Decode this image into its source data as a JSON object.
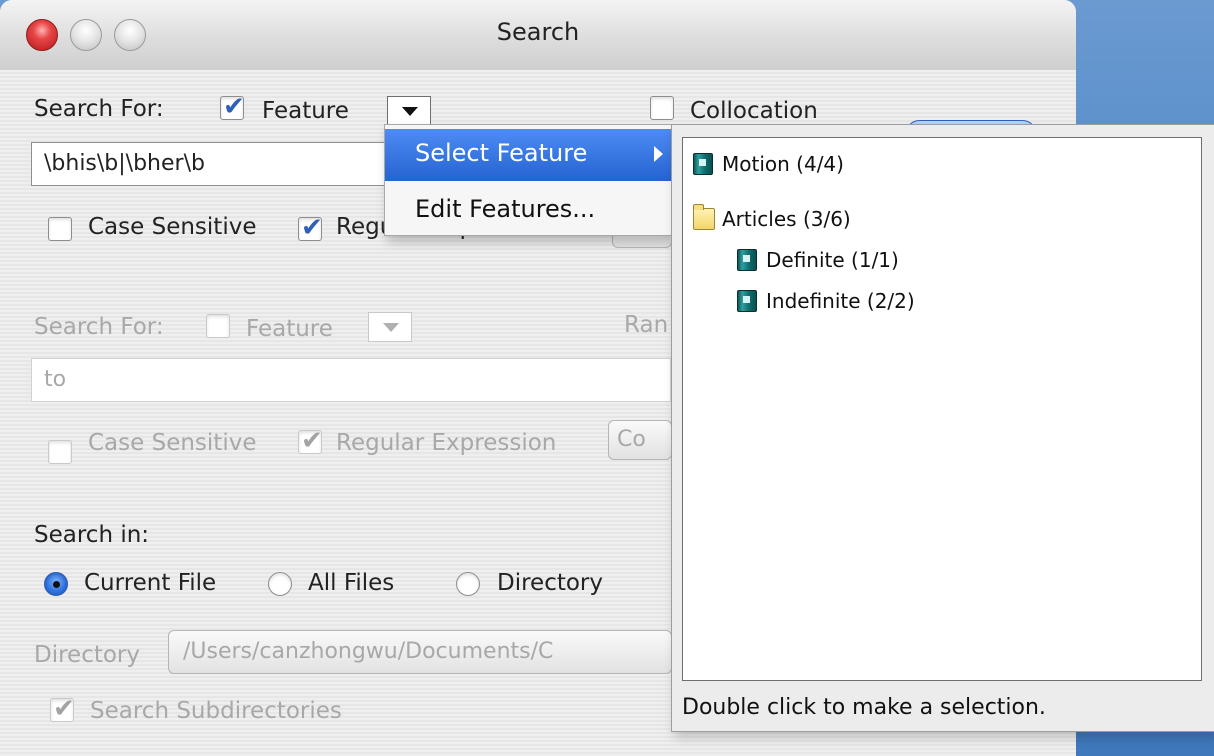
{
  "window": {
    "title": "Search"
  },
  "search1": {
    "label": "Search For:",
    "feature_label": "Feature",
    "feature_checked": true,
    "collocation_label": "Collocation",
    "collocation_checked": false,
    "query_value": "\\bhis\\b|\\bher\\b",
    "case_sensitive_label": "Case Sensitive",
    "case_sensitive_checked": false,
    "regex_label": "Regular Expression",
    "regex_checked": true
  },
  "menu": {
    "items": [
      {
        "label": "Select Feature",
        "highlighted": true,
        "has_submenu": true
      },
      {
        "label": "Edit Features...",
        "highlighted": false,
        "has_submenu": false
      }
    ]
  },
  "feature_panel": {
    "tree": [
      {
        "label": "Motion (4/4)",
        "icon": "book-icon",
        "level": 0
      },
      {
        "label": "Articles (3/6)",
        "icon": "folder-icon",
        "level": 0
      },
      {
        "label": "Definite (1/1)",
        "icon": "book-icon",
        "level": 1
      },
      {
        "label": "Indefinite (2/2)",
        "icon": "book-icon",
        "level": 1
      }
    ],
    "hint": "Double click to make a selection."
  },
  "search2": {
    "label": "Search For:",
    "feature_label": "Feature",
    "feature_checked": false,
    "range_label_visible": "Ran",
    "query_value": "to",
    "case_sensitive_label": "Case Sensitive",
    "case_sensitive_checked": false,
    "regex_label": "Regular Expression",
    "regex_checked": true,
    "side_button_visible": "Co"
  },
  "search_in": {
    "label": "Search in:",
    "options": [
      {
        "label": "Current File",
        "selected": true
      },
      {
        "label": "All Files",
        "selected": false
      },
      {
        "label": "Directory",
        "selected": false
      }
    ],
    "directory_label": "Directory",
    "directory_value": "/Users/canzhongwu/Documents/C",
    "subdirectories_label": "Search Subdirectories",
    "subdirectories_checked": true
  }
}
